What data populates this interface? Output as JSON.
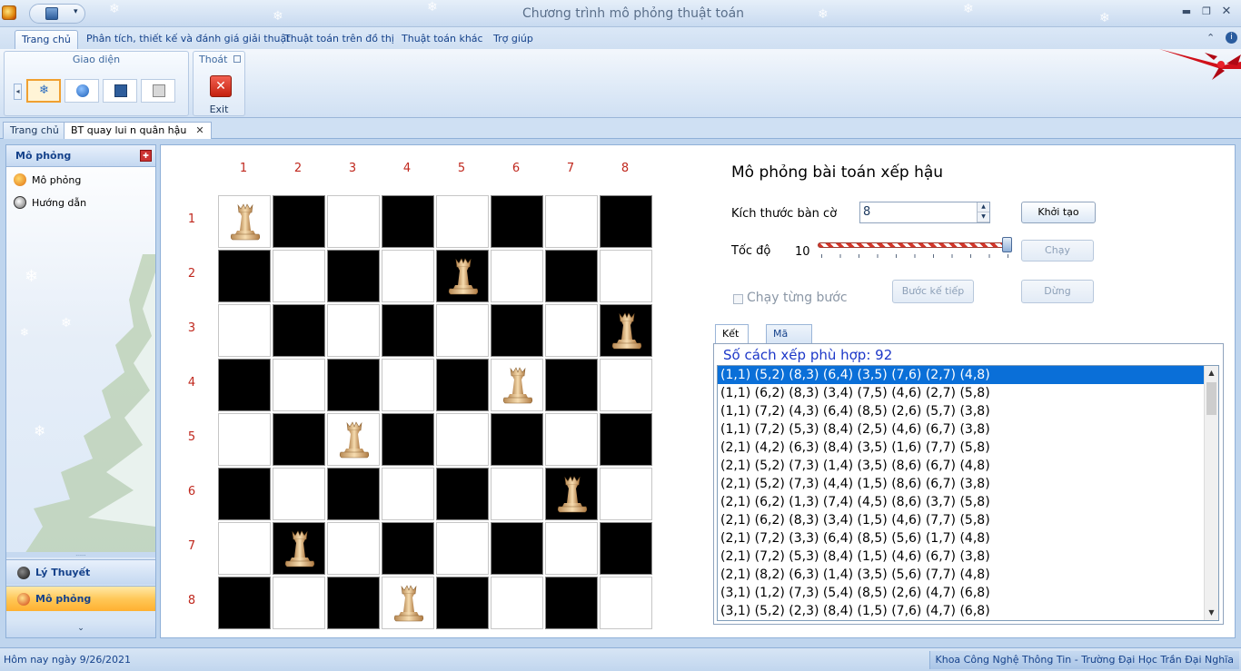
{
  "window": {
    "title": "Chương trình mô phỏng thuật toán"
  },
  "ribbon_tabs": [
    "Trang chủ",
    "Phân tích, thiết kế và đánh giá giải thuật",
    "Thuật toán trên đồ thị",
    "Thuật toán khác",
    "Trợ giúp"
  ],
  "ribbon": {
    "group_theme": "Giao diện",
    "group_exit": "Thoát",
    "exit_label": "Exit",
    "themes": [
      "snowflake-theme",
      "apple-theme",
      "blue-theme",
      "grey-theme"
    ]
  },
  "doc_tabs": [
    "Trang chủ",
    "BT quay lui n quân hậu"
  ],
  "sidebar": {
    "header": "Mô phỏng",
    "items": [
      "Mô phỏng",
      "Hướng dẫn"
    ],
    "sections": [
      "Lý Thuyết",
      "Mô phỏng"
    ],
    "splitter": "......",
    "footer_chevron": "⌄"
  },
  "board": {
    "size": 8,
    "col_labels": [
      "1",
      "2",
      "3",
      "4",
      "5",
      "6",
      "7",
      "8"
    ],
    "row_labels": [
      "1",
      "2",
      "3",
      "4",
      "5",
      "6",
      "7",
      "8"
    ],
    "queens": [
      [
        1,
        1
      ],
      [
        2,
        5
      ],
      [
        3,
        8
      ],
      [
        4,
        6
      ],
      [
        5,
        3
      ],
      [
        6,
        7
      ],
      [
        7,
        2
      ],
      [
        8,
        4
      ]
    ]
  },
  "controls": {
    "title": "Mô phỏng bài toán xếp hậu",
    "board_size_label": "Kích thước bàn cờ",
    "board_size_value": "8",
    "init_button": "Khởi tạo",
    "speed_label": "Tốc độ",
    "speed_value": "10",
    "speed_level": 1.0,
    "run_button": "Chạy",
    "step_checkbox": "Chạy từng bước",
    "next_button": "Bước kế tiếp",
    "stop_button": "Dừng"
  },
  "result": {
    "tabs": [
      "Kết quả",
      "Mã nguồn"
    ],
    "count_text": "Số cách xếp phù hợp: 92",
    "rows": [
      "(1,1) (5,2) (8,3) (6,4) (3,5) (7,6) (2,7) (4,8)",
      "(1,1) (6,2) (8,3) (3,4) (7,5) (4,6) (2,7) (5,8)",
      "(1,1) (7,2) (4,3) (6,4) (8,5) (2,6) (5,7) (3,8)",
      "(1,1) (7,2) (5,3) (8,4) (2,5) (4,6) (6,7) (3,8)",
      "(2,1) (4,2) (6,3) (8,4) (3,5) (1,6) (7,7) (5,8)",
      "(2,1) (5,2) (7,3) (1,4) (3,5) (8,6) (6,7) (4,8)",
      "(2,1) (5,2) (7,3) (4,4) (1,5) (8,6) (6,7) (3,8)",
      "(2,1) (6,2) (1,3) (7,4) (4,5) (8,6) (3,7) (5,8)",
      "(2,1) (6,2) (8,3) (3,4) (1,5) (4,6) (7,7) (5,8)",
      "(2,1) (7,2) (3,3) (6,4) (8,5) (5,6) (1,7) (4,8)",
      "(2,1) (7,2) (5,3) (8,4) (1,5) (4,6) (6,7) (3,8)",
      "(2,1) (8,2) (6,3) (1,4) (3,5) (5,6) (7,7) (4,8)",
      "(3,1) (1,2) (7,3) (5,4) (8,5) (2,6) (4,7) (6,8)",
      "(3,1) (5,2) (2,3) (8,4) (1,5) (7,6) (4,7) (6,8)"
    ],
    "selected_index": 0
  },
  "status": {
    "left": "Hôm nay ngày 9/26/2021",
    "right": "Khoa Công Nghệ Thông Tin - Trường Đại Học Trần Đại Nghĩa"
  },
  "colors": {
    "accent": "#15428b",
    "board_number": "#c0281e",
    "selection": "#0a6fd8",
    "result_title": "#1c37c8"
  }
}
